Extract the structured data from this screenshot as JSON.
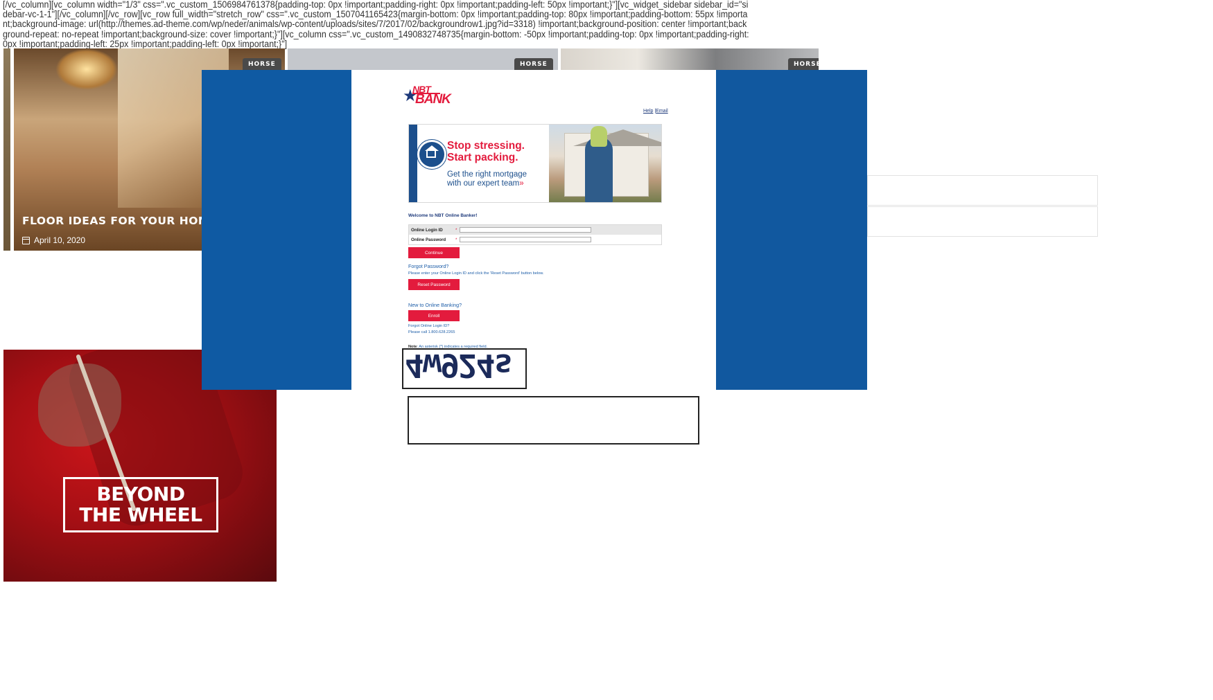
{
  "shortcode_text": "[/vc_column][vc_column width=\"1/3\" css=\".vc_custom_1506984761378{padding-top: 0px !important;padding-right: 0px !important;padding-left: 50px !important;}\"][vc_widget_sidebar sidebar_id=\"sidebar-vc-1-1\"][/vc_column][/vc_row][vc_row full_width=\"stretch_row\" css=\".vc_custom_1507041165423{margin-bottom: 0px !important;padding-top: 80px !important;padding-bottom: 55px !important;background-image: url(http://themes.ad-theme.com/wp/neder/animals/wp-content/uploads/sites/7/2017/02/backgroundrow1.jpg?id=3318) !important;background-position: center !important;background-repeat: no-repeat !important;background-size: cover !important;}\"][vc_column css=\".vc_custom_1490832748735{margin-bottom: -50px !important;padding-top: 0px !important;padding-right: 0px !important;padding-left: 25px !important;padding-left: 0px !important;}\"]",
  "cards": [
    {
      "tag": "HORSE",
      "title": "FLOOR IDEAS FOR YOUR HOME",
      "date": "April 10, 2020"
    },
    {
      "tag": "HORSE"
    },
    {
      "tag": "HORSE"
    }
  ],
  "login": {
    "logo_top": "NBT",
    "logo_bottom": "BANK",
    "help": "Help",
    "email": "Email",
    "banner_headline_1": "Stop stressing.",
    "banner_headline_2": "Start packing.",
    "banner_sub_1": "Get the right mortgage",
    "banner_sub_2": "with our expert team",
    "banner_arrow": "»",
    "welcome": "Welcome to NBT Online Banker!",
    "login_id_label": "Online Login ID",
    "password_label": "Online Password",
    "required_mark": "*",
    "continue": "Continue",
    "forgot_password": "Forgot Password?",
    "forgot_password_help": "Please enter your Online Login ID and click the 'Reset Password' button below.",
    "reset_password": "Reset Password",
    "new_to_banking": "New to Online Banking?",
    "enroll": "Enroll",
    "forgot_login_id": "Forgot Online Login ID?",
    "call_text": "Please call 1.800.628.2265",
    "note_label": "Note",
    "note_text": ": An asterisk (*) indicates a required field."
  },
  "captcha": {
    "code": "4w924s"
  },
  "promo": {
    "line1": "BEYOND",
    "line2": "THE WHEEL"
  },
  "colors": {
    "overlay_blue": "#11589f",
    "brand_red": "#e31b3d",
    "brand_navy": "#1e3a7b",
    "promo_red": "#b3131a"
  }
}
